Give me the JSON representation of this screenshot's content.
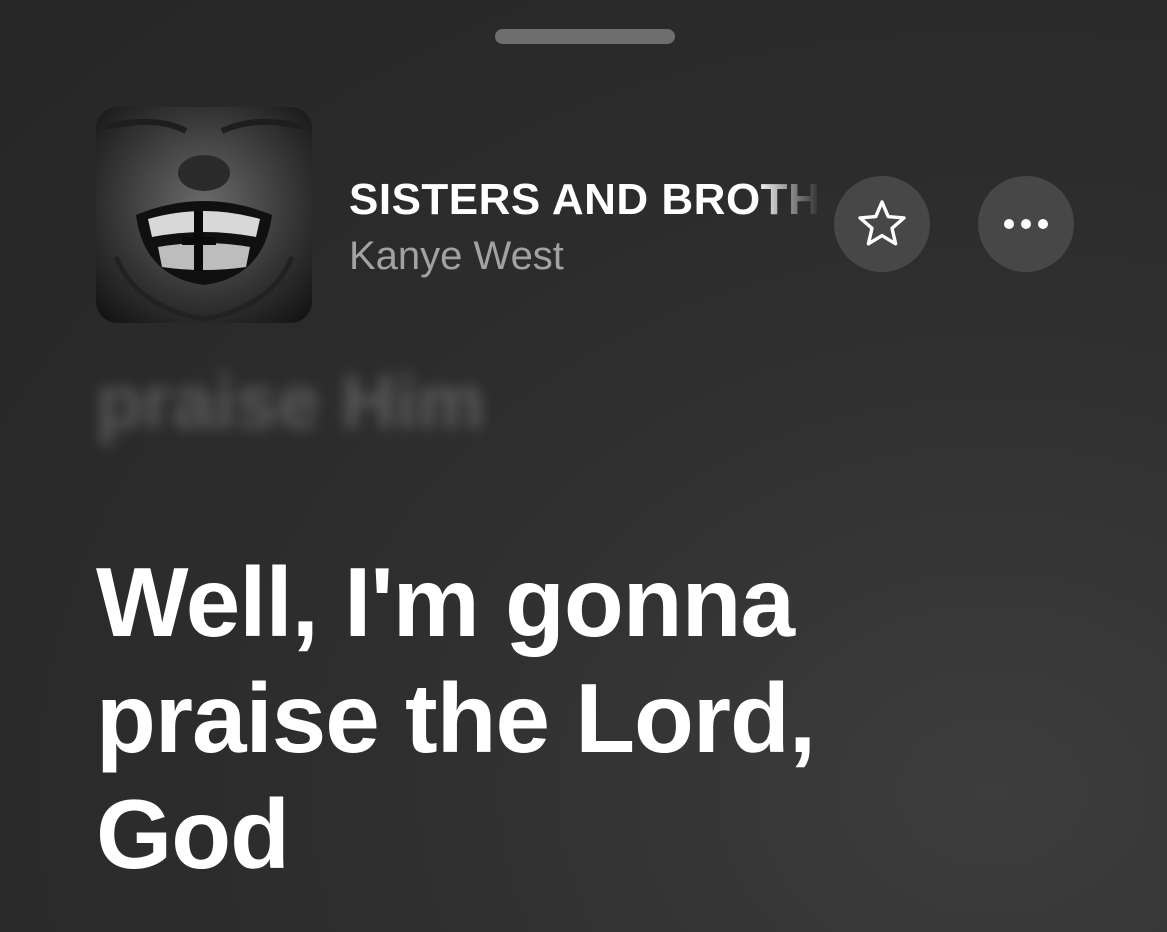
{
  "header": {
    "grabber_icon": "sheet-grabber"
  },
  "now_playing": {
    "artwork_icon": "album-artwork",
    "title": "SISTERS AND BROTHERS",
    "artist": "Kanye West",
    "favorite_icon": "star-outline-icon",
    "more_icon": "ellipsis-icon"
  },
  "lyrics": {
    "previous_line": "praise Him",
    "current_lines": [
      "Well, I'm gonna",
      "praise the Lord,",
      "God"
    ]
  },
  "colors": {
    "background": "#2e2e2e",
    "button_fill": "#474747",
    "artist_text": "#a2a2a4",
    "grabber": "#6e6e70"
  }
}
